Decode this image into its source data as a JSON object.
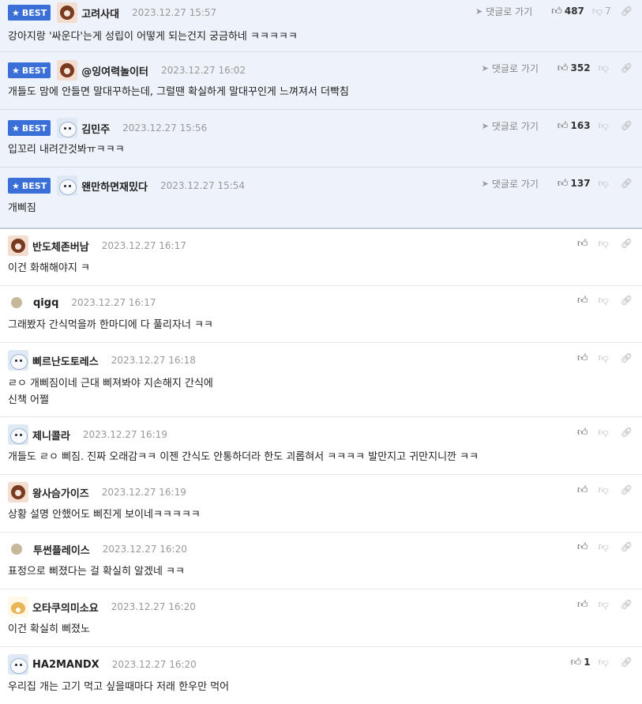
{
  "labels": {
    "best": "BEST",
    "reply": "댓글로 가기"
  },
  "colors": {
    "accent": "#3a6fd8",
    "best_bg": "#eef2fa"
  },
  "comments": [
    {
      "nick": "고려사대",
      "date": "2023.12.27 15:57",
      "text": "강아지랑 '싸운다'는게 성립이 어떻게 되는건지 궁금하네 ㅋㅋㅋㅋㅋ",
      "up": "487",
      "down": "7",
      "best": true,
      "avatar": "dog"
    },
    {
      "nick": "@잉여력놀이터",
      "date": "2023.12.27 16:02",
      "text": "개들도 맘에 안들면 말대꾸하는데, 그럴땐 확실하게 말대꾸인게 느껴져서 더빡침",
      "up": "352",
      "down": "",
      "best": true,
      "avatar": "dog"
    },
    {
      "nick": "김민주",
      "date": "2023.12.27 15:56",
      "text": "입꼬리 내려간것봐ㅠㅋㅋㅋ",
      "up": "163",
      "down": "",
      "best": true,
      "avatar": "white"
    },
    {
      "nick": "왠만하면재밌다",
      "date": "2023.12.27 15:54",
      "text": "개삐짐",
      "up": "137",
      "down": "",
      "best": true,
      "avatar": "white"
    },
    {
      "nick": "반도체존버남",
      "date": "2023.12.27 16:17",
      "text": "이건 화해해야지 ㅋ",
      "up": "",
      "down": "",
      "best": false,
      "avatar": "dog"
    },
    {
      "nick": "qigq",
      "date": "2023.12.27 16:17",
      "text": "그래봤자 간식먹을까 한마디에 다 풀리자너 ㅋㅋ",
      "up": "",
      "down": "",
      "best": false,
      "avatar": "dot"
    },
    {
      "nick": "삐르난도토레스",
      "date": "2023.12.27 16:18",
      "text": "ㄹㅇ 개삐짐이네 근대 삐져봐야 지손해지 간식에\n신책 어쩔",
      "up": "",
      "down": "",
      "best": false,
      "avatar": "white"
    },
    {
      "nick": "제니콜라",
      "date": "2023.12.27 16:19",
      "text": "개들도 ㄹㅇ 삐짐. 진짜 오래감ㅋㅋ 이젠 간식도 안통하더라 한도 괴롭혀서 ㅋㅋㅋㅋ 발만지고 귀만지니깐 ㅋㅋ",
      "up": "",
      "down": "",
      "best": false,
      "avatar": "white"
    },
    {
      "nick": "왕사슴가이즈",
      "date": "2023.12.27 16:19",
      "text": "상황 설명 안했어도 삐진게 보이네ㅋㅋㅋㅋㅋ",
      "up": "",
      "down": "",
      "best": false,
      "avatar": "dog"
    },
    {
      "nick": "투썬플레이스",
      "date": "2023.12.27 16:20",
      "text": "표정으로 삐졌다는 걸 확실히 알겠네 ㅋㅋ",
      "up": "",
      "down": "",
      "best": false,
      "avatar": "dot"
    },
    {
      "nick": "오타쿠의미소요",
      "date": "2023.12.27 16:20",
      "text": "이건 확실히 삐졌노",
      "up": "",
      "down": "",
      "best": false,
      "avatar": "fox"
    },
    {
      "nick": "HA2MANDX",
      "date": "2023.12.27 16:20",
      "text": "우리집 개는 고기 먹고 싶을때마다 저래 한우만 먹어",
      "up": "1",
      "down": "",
      "best": false,
      "avatar": "white"
    }
  ]
}
